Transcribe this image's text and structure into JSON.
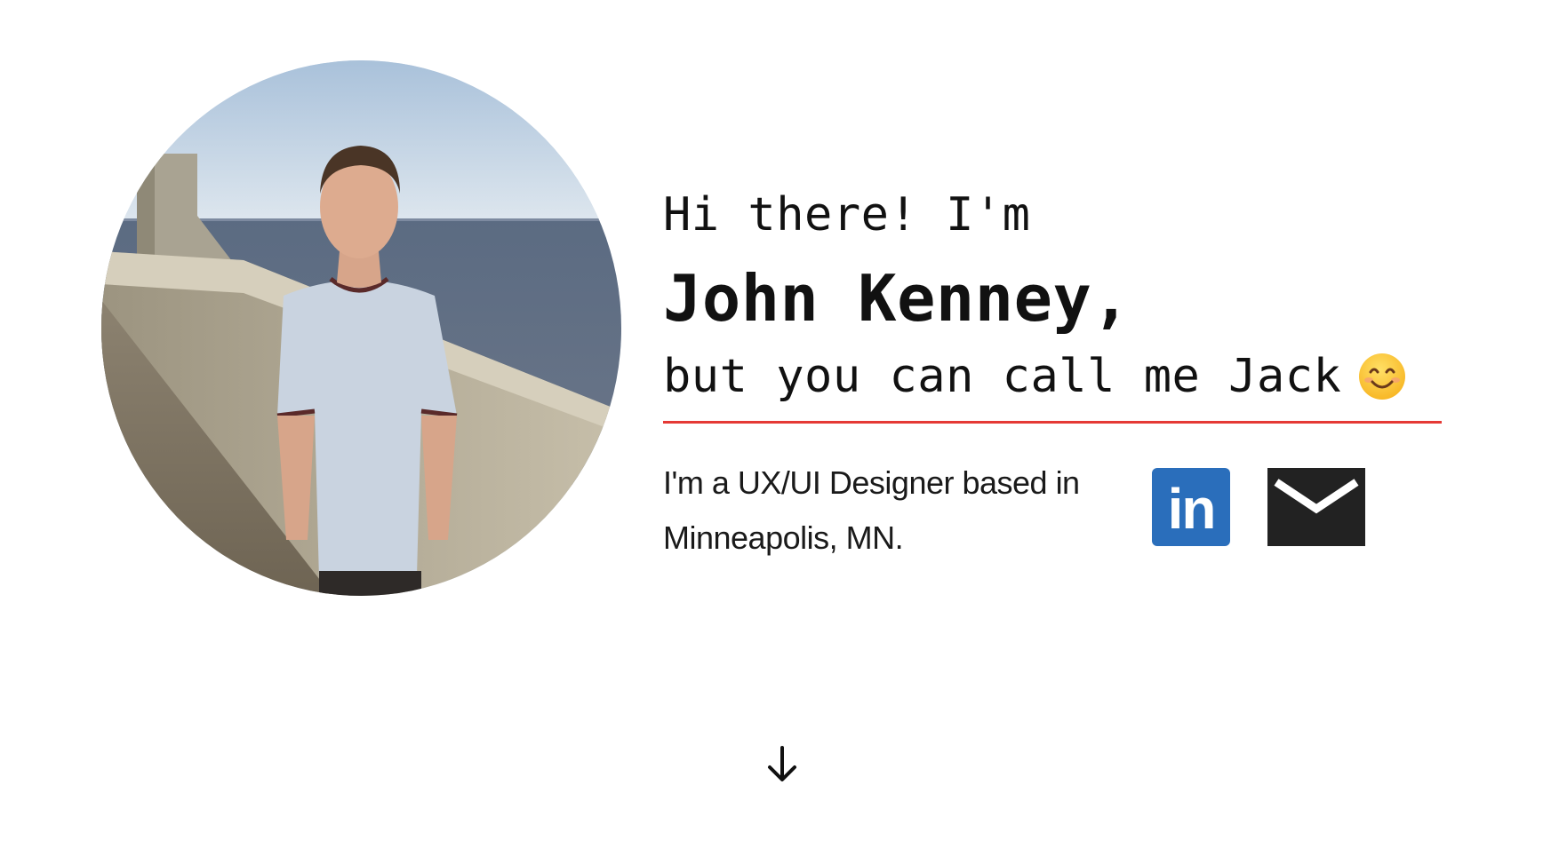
{
  "hero": {
    "photo_alt": "Portrait photo",
    "greeting": "Hi there! I'm",
    "name": "John Kenney,",
    "nickname": "but you can call me Jack",
    "emoji": "smiling-face-icon",
    "bio_line1": "I'm a UX/UI Designer based in",
    "bio_line2": "Minneapolis, MN.",
    "accent_color": "#e53935"
  },
  "social": {
    "linkedin_label": "in",
    "linkedin_icon": "linkedin-icon",
    "linkedin_color": "#2a6ebb",
    "email_icon": "envelope-icon",
    "email_color": "#222222"
  },
  "scroll": {
    "icon": "arrow-down-icon"
  }
}
